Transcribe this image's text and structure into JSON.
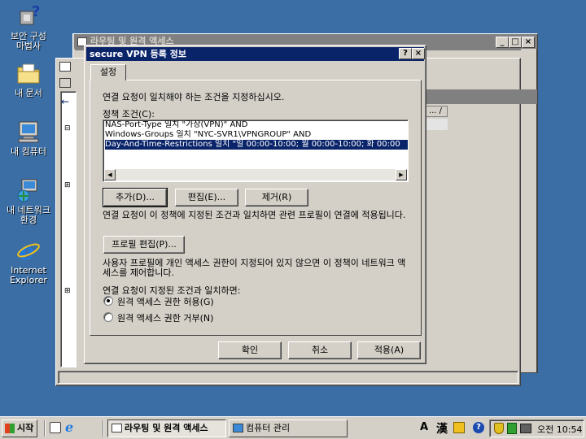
{
  "desktop": {
    "icons": [
      {
        "label": "보안 구성\n마법사"
      },
      {
        "label": "내 문서"
      },
      {
        "label": "내 컴퓨터"
      },
      {
        "label": "내 네트워크\n환경"
      },
      {
        "label": "Internet\nExplorer"
      }
    ]
  },
  "bg_window": {
    "title": "라우팅 및 원격 액세스",
    "col_header": "... /"
  },
  "dialog": {
    "title": "secure VPN 등록 정보",
    "help_btn": "?",
    "close_btn": "×",
    "tab": "설정",
    "instruction": "연결 요청이 일치해야 하는 조건을 지정하십시오.",
    "policy_label": "정책 조건(C):",
    "conditions": [
      "NAS-Port-Type 일치 \"가상(VPN)\" AND",
      "Windows-Groups 일치 \"NYC-SVR1\\VPNGROUP\" AND",
      "Day-And-Time-Restrictions 일치 \"일 00:00-10:00; 월 00:00-10:00; 화 00:00"
    ],
    "add_btn": "추가(D)...",
    "edit_btn": "편집(E)...",
    "remove_btn": "제거(R)",
    "profile_text": "연결 요청이 이 정책에 지정된 조건과 일치하면 관련 프로필이 연결에 적용됩니다.",
    "profile_btn": "프로필 편집(P)...",
    "access_text": "사용자 프로필에 개인 액세스 권한이 지정되어 있지 않으면 이 정책이 네트워크 액세스를 제어합니다.",
    "match_label": "연결 요청이 지정된 조건과 일치하면:",
    "grant": "원격 액세스 권한 허용(G)",
    "deny": "원격 액세스 권한 거부(N)",
    "ok": "확인",
    "cancel": "취소",
    "apply": "적용(A)"
  },
  "taskbar": {
    "start": "시작",
    "tasks": [
      "라우팅 및 원격 액세스",
      "컴퓨터 관리"
    ],
    "clock": "오전 10:54",
    "ime_a": "A",
    "ime_han": "漢"
  },
  "colors": {
    "desktop": "#3a6ea5",
    "title_active": "#0a246a",
    "selection": "#0a246a"
  }
}
